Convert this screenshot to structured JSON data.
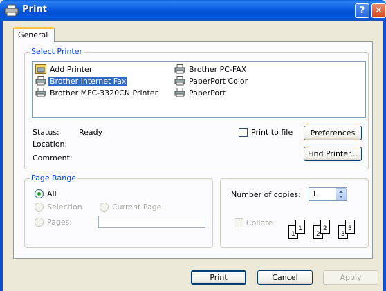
{
  "window": {
    "title": "Print",
    "help_label": "?",
    "close_label": "✕"
  },
  "tabs": [
    {
      "label": "General"
    }
  ],
  "select_printer": {
    "legend": "Select Printer",
    "printers": [
      {
        "label": "Add Printer",
        "icon": "add-printer-icon"
      },
      {
        "label": "Brother Internet Fax",
        "icon": "printer-icon",
        "selected": true
      },
      {
        "label": "Brother MFC-3320CN Printer",
        "icon": "printer-icon"
      },
      {
        "label": "Brother PC-FAX",
        "icon": "printer-icon"
      },
      {
        "label": "PaperPort Color",
        "icon": "printer-icon"
      },
      {
        "label": "PaperPort",
        "icon": "printer-icon"
      }
    ],
    "status_label": "Status:",
    "status_value": "Ready",
    "location_label": "Location:",
    "comment_label": "Comment:",
    "print_to_file_label": "Print to file",
    "preferences_label": "Preferences",
    "find_printer_label": "Find Printer..."
  },
  "page_range": {
    "legend": "Page Range",
    "all_label": "All",
    "selection_label": "Selection",
    "current_page_label": "Current Page",
    "pages_label": "Pages:",
    "pages_value": ""
  },
  "copies": {
    "number_label": "Number of copies:",
    "number_value": "1",
    "collate_label": "Collate",
    "collate_pages": [
      "1",
      "1",
      "2",
      "2",
      "3",
      "3"
    ]
  },
  "footer": {
    "print_label": "Print",
    "cancel_label": "Cancel",
    "apply_label": "Apply"
  },
  "colors": {
    "titlebar": "#0458df",
    "dialog_bg": "#ece9d8",
    "selection": "#316ac5",
    "group_legend": "#0046d5"
  }
}
